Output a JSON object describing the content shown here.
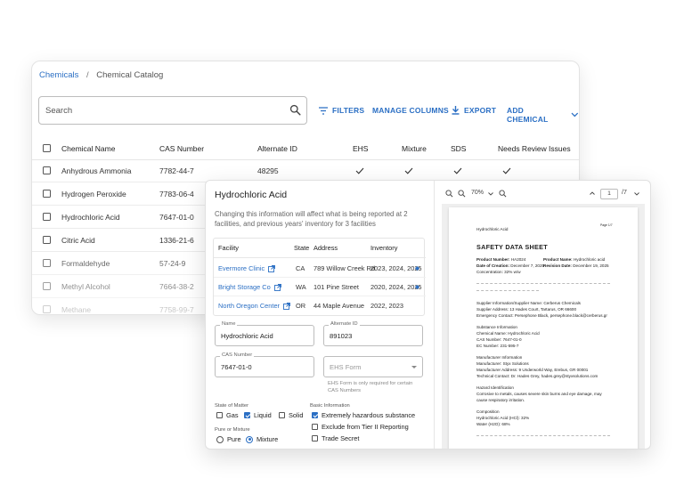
{
  "catalog": {
    "breadcrumb": {
      "parent": "Chemicals",
      "separator": "/",
      "current": "Chemical Catalog"
    },
    "search": {
      "placeholder": "Search",
      "value": ""
    },
    "toolbar": {
      "filters": "FILTERS",
      "manage_columns": "MANAGE COLUMNS",
      "export": "EXPORT",
      "add_chemical": "ADD CHEMICAL"
    },
    "columns": [
      "Chemical Name",
      "CAS Number",
      "Alternate ID",
      "EHS",
      "Mixture",
      "SDS",
      "Needs Review",
      "Issues"
    ],
    "rows": [
      {
        "name": "Anhydrous Ammonia",
        "cas": "7782-44-7",
        "alt_id": "48295",
        "ehs": true,
        "mixture": true,
        "sds": true,
        "review": true
      },
      {
        "name": "Hydrogen Peroxide",
        "cas": "7783-06-4",
        "alt_id": "",
        "ehs": false,
        "mixture": false,
        "sds": false,
        "review": false
      },
      {
        "name": "Hydrochloric Acid",
        "cas": "7647-01-0",
        "alt_id": "",
        "ehs": false,
        "mixture": false,
        "sds": false,
        "review": false
      },
      {
        "name": "Citric Acid",
        "cas": "1336-21-6",
        "alt_id": "",
        "ehs": false,
        "mixture": false,
        "sds": false,
        "review": false
      },
      {
        "name": "Formaldehyde",
        "cas": "57-24-9",
        "alt_id": "",
        "ehs": false,
        "mixture": false,
        "sds": false,
        "review": false
      },
      {
        "name": "Methyl Alcohol",
        "cas": "7664-38-2",
        "alt_id": "",
        "ehs": false,
        "mixture": false,
        "sds": false,
        "review": false
      },
      {
        "name": "Methane",
        "cas": "7758-99-7",
        "alt_id": "",
        "ehs": false,
        "mixture": false,
        "sds": false,
        "review": false
      }
    ]
  },
  "detail": {
    "title": "Hydrochloric Acid",
    "warning": "Changing this information will affect what is being reported at 2 facilities, and previous years' inventory for 3 facilities",
    "facility_table": {
      "headers": [
        "Facility",
        "State",
        "Address",
        "Inventory"
      ],
      "rows": [
        {
          "facility": "Evermore Clinic",
          "state": "CA",
          "address": "789 Willow Creek Rd",
          "inventory": "2023, 2024, 2025",
          "info": true
        },
        {
          "facility": "Bright Storage Co",
          "state": "WA",
          "address": "101 Pine Street",
          "inventory": "2020, 2024, 2025",
          "info": true
        },
        {
          "facility": "North Oregon Center",
          "state": "OR",
          "address": "44 Maple Avenue",
          "inventory": "2022, 2023",
          "info": false
        }
      ]
    },
    "fields": {
      "name": {
        "label": "Name",
        "value": "Hydrochloric Acid"
      },
      "alternate_id": {
        "label": "Alternate ID",
        "value": "891023"
      },
      "cas_number": {
        "label": "CAS Number",
        "value": "7647-01-0"
      },
      "ehs_form": {
        "placeholder": "EHS Form",
        "hint": "EHS Form is only required for certain CAS Numbers"
      }
    },
    "state_of_matter": {
      "label": "State of Matter",
      "options": [
        {
          "label": "Gas",
          "checked": false
        },
        {
          "label": "Liquid",
          "checked": true
        },
        {
          "label": "Solid",
          "checked": false
        }
      ]
    },
    "pure_or_mixture": {
      "label": "Pure or Mixture",
      "options": [
        {
          "label": "Pure",
          "checked": false
        },
        {
          "label": "Mixture",
          "checked": true
        }
      ]
    },
    "basic_information": {
      "label": "Basic Information",
      "options": [
        {
          "label": "Extremely hazardous substance",
          "checked": true
        },
        {
          "label": "Exclude from Tier II Reporting",
          "checked": false
        },
        {
          "label": "Trade Secret",
          "checked": false
        }
      ]
    }
  },
  "sds_viewer": {
    "zoom": "70%",
    "page": "1",
    "page_total": "/7",
    "document": {
      "header_name": "Hydrochloric Acid",
      "page_label": "Page 1/7",
      "title": "SAFETY DATA SHEET",
      "line1_label": "Product Number:",
      "line1_value": "HA2024",
      "line1b_label": "Product Name:",
      "line1b_value": "Hydrochloric acid",
      "line2_label": "Date of Creation:",
      "line2_value": "December 7, 2025",
      "line2b_label": "Revision Date:",
      "line2b_value": "December 19, 2025",
      "line3": "Concentration: 32% w/w",
      "supplier": [
        "Supplier Information/Supplier Name: Cerberus Chemicals",
        "Supplier Address: 13 Hades Court, Tartarus, OR 66600",
        "Emergency Contact: Persephone Black, persephone.black@cerberus.gr"
      ],
      "substance": [
        "Substance Information",
        "Chemical Name: Hydrochloric Acid",
        "CAS Number: 7647-01-0",
        "EC Number: 231-595-7"
      ],
      "manufacturer": [
        "Manufacturer Information",
        "Manufacturer: Styx Solutions",
        "Manufacturer Address: 9 Underworld Way, Erebus, GR 00001",
        "Technical Contact: Dr. Hades Grey, hades.grey@styxsolutions.com"
      ],
      "hazard": [
        "Hazard Identification",
        "Corrosive to metals, causes severe skin burns and eye damage, may",
        "cause respiratory irritation."
      ],
      "composition": [
        "Composition",
        "Hydrochloric Acid (HCl): 32%",
        "Water (H2O): 68%"
      ]
    }
  },
  "colors": {
    "accent": "#2b6fc4",
    "text": "#333333",
    "border": "#e3e3e3"
  },
  "icons": [
    "search-icon",
    "filter-icon",
    "download-icon",
    "chevron-down-icon",
    "check-icon",
    "open-in-new-icon",
    "info-diamond-icon",
    "zoom-in-icon",
    "zoom-out-icon",
    "chevron-up-icon"
  ]
}
